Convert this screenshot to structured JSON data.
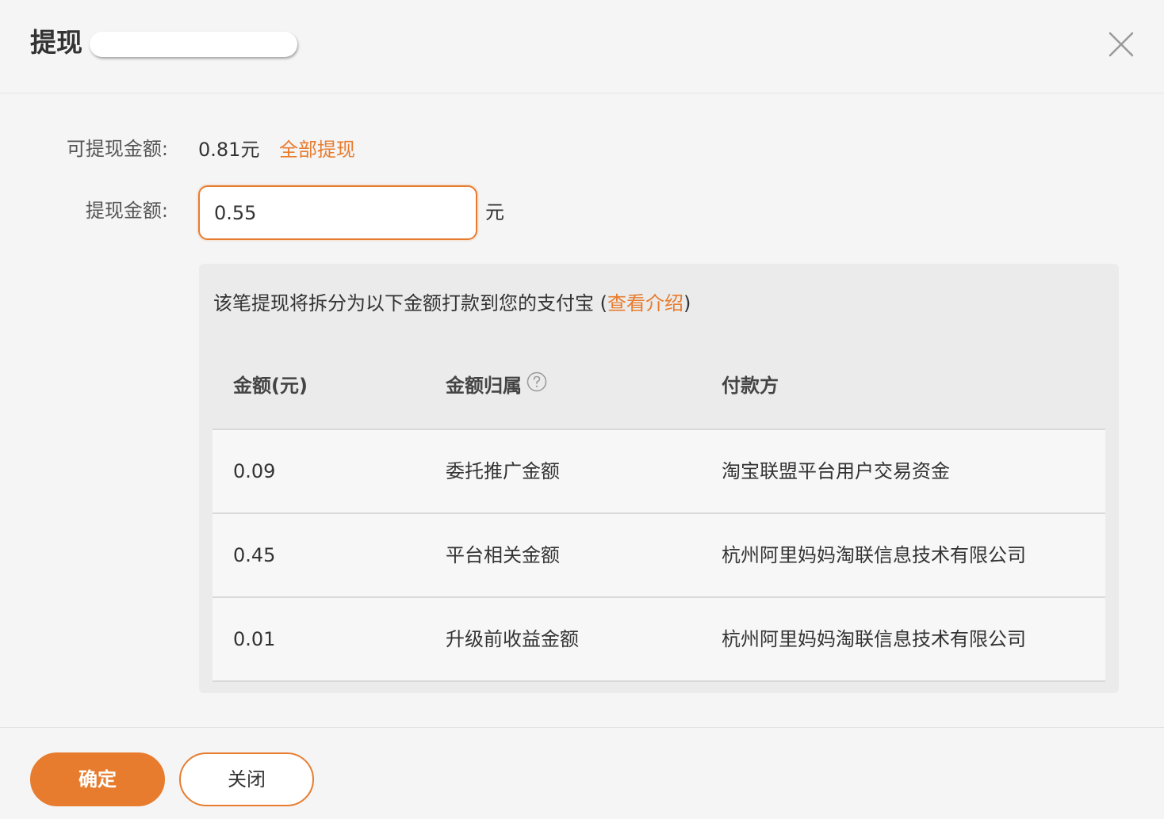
{
  "dialog": {
    "title": "提现",
    "close_icon": "close-icon"
  },
  "form": {
    "available_label": "可提现金额:",
    "available_value": "0.81元",
    "withdraw_all_label": "全部提现",
    "amount_label": "提现金额:",
    "amount_value": "0.55",
    "amount_unit": "元"
  },
  "split_panel": {
    "note_prefix": "该笔提现将拆分为以下金额打款到您的支付宝 (",
    "note_link": "查看介绍",
    "note_suffix": ")",
    "columns": [
      "金额(元)",
      "金额归属",
      "付款方"
    ],
    "help_icon": "question-circle-icon",
    "rows": [
      {
        "amount": "0.09",
        "category": "委托推广金额",
        "payer": "淘宝联盟平台用户交易资金"
      },
      {
        "amount": "0.45",
        "category": "平台相关金额",
        "payer": "杭州阿里妈妈淘联信息技术有限公司"
      },
      {
        "amount": "0.01",
        "category": "升级前收益金额",
        "payer": "杭州阿里妈妈淘联信息技术有限公司"
      }
    ]
  },
  "footer": {
    "confirm_label": "确定",
    "close_label": "关闭"
  },
  "colors": {
    "accent": "#e87c2e",
    "background": "#f5f5f5",
    "panel": "#ebebeb"
  }
}
